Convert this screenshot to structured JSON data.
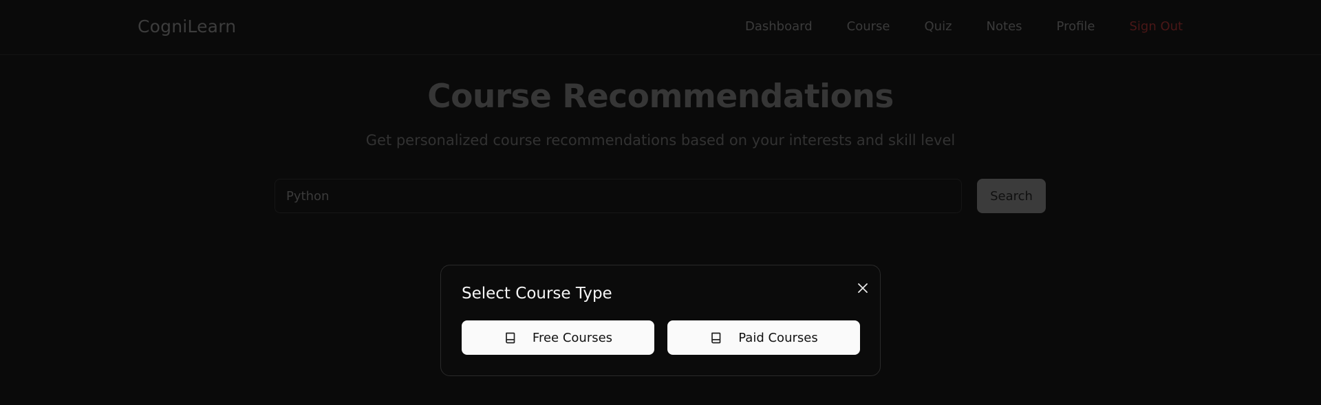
{
  "app": {
    "brand": "CogniLearn"
  },
  "nav": {
    "items": [
      {
        "label": "Dashboard"
      },
      {
        "label": "Course"
      },
      {
        "label": "Quiz"
      },
      {
        "label": "Notes"
      },
      {
        "label": "Profile"
      }
    ],
    "sign_out": "Sign Out",
    "sign_out_color": "#4a1717"
  },
  "hero": {
    "title": "Course Recommendations",
    "subtitle": "Get personalized course recommendations based on your interests and skill level"
  },
  "search": {
    "value": "Python",
    "button_label": "Search"
  },
  "modal": {
    "title": "Select Course Type",
    "close_icon": "close-icon",
    "options": [
      {
        "label": "Free Courses",
        "icon": "book-icon"
      },
      {
        "label": "Paid Courses",
        "icon": "book-icon"
      }
    ]
  },
  "colors": {
    "background": "#0a0a0a",
    "modal_background": "#0b0b0b",
    "option_button": "#fafafa"
  }
}
